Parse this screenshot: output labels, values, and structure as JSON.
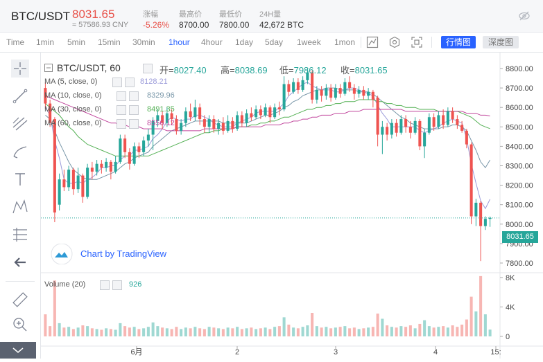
{
  "header": {
    "pair": "BTC/USDT",
    "price": "8031.65",
    "cny": "≈ 57586.93 CNY",
    "stats": [
      {
        "label": "涨幅",
        "value": "-5.26%",
        "color": "#e8524a"
      },
      {
        "label": "最高价",
        "value": "8700.00",
        "color": "#333333"
      },
      {
        "label": "最低价",
        "value": "7800.00",
        "color": "#333333"
      },
      {
        "label": "24H量",
        "value": "42,672 BTC",
        "color": "#333333"
      }
    ]
  },
  "toolbar": {
    "intervals": [
      "Time",
      "1min",
      "5min",
      "15min",
      "30min",
      "1hour",
      "4hour",
      "1day",
      "5day",
      "1week",
      "1mon"
    ],
    "active": "1hour",
    "view_kline": "行情图",
    "view_depth": "深度图"
  },
  "legend": {
    "title": "BTC/USDT, 60",
    "open_label": "开=",
    "open": "8027.40",
    "high_label": "高=",
    "high": "8038.69",
    "low_label": "低=",
    "low": "7986.12",
    "close_label": "收=",
    "close": "8031.65",
    "ma": [
      {
        "label": "MA (5, close, 0)",
        "value": "8128.21",
        "color": "#9a9ad9"
      },
      {
        "label": "MA (10, close, 0)",
        "value": "8329.96",
        "color": "#7896a8"
      },
      {
        "label": "MA (30, close, 0)",
        "value": "8491.35",
        "color": "#53b053"
      },
      {
        "label": "MA (60, close, 0)",
        "value": "8556.12",
        "color": "#c0449c"
      }
    ],
    "volume_label": "Volume (20)",
    "volume_value": "926",
    "tv_text": "Chart by TradingView"
  },
  "colors": {
    "up": "#26a69a",
    "down": "#ef5350",
    "up_vol": "#9fd8d2",
    "down_vol": "#f7b6b3"
  },
  "chart_data": {
    "type": "candlestick",
    "price_axis": [
      7800,
      7900,
      8000,
      8100,
      8200,
      8300,
      8400,
      8500,
      8600,
      8700,
      8800
    ],
    "volume_axis": [
      "0",
      "4K",
      "8K"
    ],
    "time_labels": [
      "6月",
      "2",
      "3",
      "4",
      "15:"
    ],
    "last_price": "8031.65",
    "candles": [
      {
        "o": 8700,
        "c": 8620,
        "h": 8730,
        "l": 8590
      },
      {
        "o": 8620,
        "c": 8520,
        "h": 8640,
        "l": 8500
      },
      {
        "o": 8540,
        "c": 8060,
        "h": 8550,
        "l": 8010
      },
      {
        "o": 8100,
        "c": 8230,
        "h": 8260,
        "l": 8070
      },
      {
        "o": 8230,
        "c": 8190,
        "h": 8280,
        "l": 8170
      },
      {
        "o": 8190,
        "c": 8280,
        "h": 8300,
        "l": 8170
      },
      {
        "o": 8280,
        "c": 8180,
        "h": 8290,
        "l": 8150
      },
      {
        "o": 8180,
        "c": 8250,
        "h": 8290,
        "l": 8160
      },
      {
        "o": 8250,
        "c": 8140,
        "h": 8260,
        "l": 8110
      },
      {
        "o": 8140,
        "c": 8290,
        "h": 8310,
        "l": 8130
      },
      {
        "o": 8290,
        "c": 8270,
        "h": 8320,
        "l": 8230
      },
      {
        "o": 8270,
        "c": 8310,
        "h": 8330,
        "l": 8250
      },
      {
        "o": 8310,
        "c": 8290,
        "h": 8330,
        "l": 8260
      },
      {
        "o": 8290,
        "c": 8320,
        "h": 8340,
        "l": 8270
      },
      {
        "o": 8320,
        "c": 8270,
        "h": 8330,
        "l": 8230
      },
      {
        "o": 8270,
        "c": 8320,
        "h": 8350,
        "l": 8260
      },
      {
        "o": 8320,
        "c": 8440,
        "h": 8460,
        "l": 8310
      },
      {
        "o": 8440,
        "c": 8370,
        "h": 8460,
        "l": 8340
      },
      {
        "o": 8370,
        "c": 8310,
        "h": 8390,
        "l": 8280
      },
      {
        "o": 8310,
        "c": 8400,
        "h": 8420,
        "l": 8300
      },
      {
        "o": 8400,
        "c": 8370,
        "h": 8420,
        "l": 8340
      },
      {
        "o": 8370,
        "c": 8430,
        "h": 8450,
        "l": 8350
      },
      {
        "o": 8430,
        "c": 8460,
        "h": 8490,
        "l": 8400
      },
      {
        "o": 8460,
        "c": 8530,
        "h": 8550,
        "l": 8380
      },
      {
        "o": 8530,
        "c": 8560,
        "h": 8590,
        "l": 8500
      },
      {
        "o": 8560,
        "c": 8520,
        "h": 8580,
        "l": 8490
      },
      {
        "o": 8520,
        "c": 8570,
        "h": 8600,
        "l": 8500
      },
      {
        "o": 8570,
        "c": 8540,
        "h": 8590,
        "l": 8510
      },
      {
        "o": 8540,
        "c": 8480,
        "h": 8560,
        "l": 8460
      },
      {
        "o": 8480,
        "c": 8520,
        "h": 8540,
        "l": 8460
      },
      {
        "o": 8520,
        "c": 8580,
        "h": 8600,
        "l": 8500
      },
      {
        "o": 8580,
        "c": 8550,
        "h": 8620,
        "l": 8530
      },
      {
        "o": 8550,
        "c": 8600,
        "h": 8640,
        "l": 8530
      },
      {
        "o": 8600,
        "c": 8540,
        "h": 8620,
        "l": 8510
      },
      {
        "o": 8540,
        "c": 8500,
        "h": 8560,
        "l": 8470
      },
      {
        "o": 8500,
        "c": 8540,
        "h": 8560,
        "l": 8470
      },
      {
        "o": 8540,
        "c": 8490,
        "h": 8560,
        "l": 8470
      },
      {
        "o": 8490,
        "c": 8520,
        "h": 8540,
        "l": 8460
      },
      {
        "o": 8520,
        "c": 8480,
        "h": 8550,
        "l": 8460
      },
      {
        "o": 8480,
        "c": 8530,
        "h": 8560,
        "l": 8470
      },
      {
        "o": 8530,
        "c": 8490,
        "h": 8550,
        "l": 8470
      },
      {
        "o": 8490,
        "c": 8560,
        "h": 8580,
        "l": 8480
      },
      {
        "o": 8560,
        "c": 8520,
        "h": 8580,
        "l": 8500
      },
      {
        "o": 8520,
        "c": 8570,
        "h": 8590,
        "l": 8500
      },
      {
        "o": 8570,
        "c": 8550,
        "h": 8600,
        "l": 8530
      },
      {
        "o": 8550,
        "c": 8590,
        "h": 8610,
        "l": 8540
      },
      {
        "o": 8590,
        "c": 8560,
        "h": 8610,
        "l": 8540
      },
      {
        "o": 8560,
        "c": 8600,
        "h": 8620,
        "l": 8550
      },
      {
        "o": 8600,
        "c": 8550,
        "h": 8610,
        "l": 8520
      },
      {
        "o": 8550,
        "c": 8600,
        "h": 8620,
        "l": 8540
      },
      {
        "o": 8600,
        "c": 8590,
        "h": 8630,
        "l": 8560
      },
      {
        "o": 8590,
        "c": 8720,
        "h": 8760,
        "l": 8580
      },
      {
        "o": 8720,
        "c": 8680,
        "h": 8740,
        "l": 8660
      },
      {
        "o": 8680,
        "c": 8730,
        "h": 8750,
        "l": 8670
      },
      {
        "o": 8730,
        "c": 8690,
        "h": 8750,
        "l": 8670
      },
      {
        "o": 8690,
        "c": 8740,
        "h": 8760,
        "l": 8680
      },
      {
        "o": 8740,
        "c": 8780,
        "h": 8800,
        "l": 8720
      },
      {
        "o": 8780,
        "c": 8640,
        "h": 8790,
        "l": 8620
      },
      {
        "o": 8640,
        "c": 8690,
        "h": 8710,
        "l": 8620
      },
      {
        "o": 8690,
        "c": 8660,
        "h": 8710,
        "l": 8630
      },
      {
        "o": 8660,
        "c": 8700,
        "h": 8720,
        "l": 8640
      },
      {
        "o": 8700,
        "c": 8650,
        "h": 8720,
        "l": 8630
      },
      {
        "o": 8650,
        "c": 8700,
        "h": 8720,
        "l": 8640
      },
      {
        "o": 8700,
        "c": 8670,
        "h": 8720,
        "l": 8650
      },
      {
        "o": 8670,
        "c": 8730,
        "h": 8750,
        "l": 8660
      },
      {
        "o": 8730,
        "c": 8700,
        "h": 8760,
        "l": 8680
      },
      {
        "o": 8700,
        "c": 8670,
        "h": 8720,
        "l": 8640
      },
      {
        "o": 8670,
        "c": 8690,
        "h": 8710,
        "l": 8650
      },
      {
        "o": 8690,
        "c": 8660,
        "h": 8710,
        "l": 8640
      },
      {
        "o": 8660,
        "c": 8680,
        "h": 8700,
        "l": 8640
      },
      {
        "o": 8680,
        "c": 8640,
        "h": 8690,
        "l": 8600
      },
      {
        "o": 8650,
        "c": 8460,
        "h": 8660,
        "l": 8400
      },
      {
        "o": 8460,
        "c": 8500,
        "h": 8530,
        "l": 8360
      },
      {
        "o": 8500,
        "c": 8460,
        "h": 8520,
        "l": 8430
      },
      {
        "o": 8460,
        "c": 8520,
        "h": 8540,
        "l": 8440
      },
      {
        "o": 8520,
        "c": 8470,
        "h": 8540,
        "l": 8450
      },
      {
        "o": 8470,
        "c": 8540,
        "h": 8560,
        "l": 8460
      },
      {
        "o": 8540,
        "c": 8500,
        "h": 8560,
        "l": 8470
      },
      {
        "o": 8500,
        "c": 8470,
        "h": 8530,
        "l": 8440
      },
      {
        "o": 8470,
        "c": 8530,
        "h": 8550,
        "l": 8460
      },
      {
        "o": 8530,
        "c": 8400,
        "h": 8540,
        "l": 8380
      },
      {
        "o": 8400,
        "c": 8470,
        "h": 8490,
        "l": 8340
      },
      {
        "o": 8470,
        "c": 8550,
        "h": 8570,
        "l": 8460
      },
      {
        "o": 8550,
        "c": 8500,
        "h": 8570,
        "l": 8480
      },
      {
        "o": 8500,
        "c": 8560,
        "h": 8580,
        "l": 8490
      },
      {
        "o": 8560,
        "c": 8510,
        "h": 8590,
        "l": 8490
      },
      {
        "o": 8510,
        "c": 8580,
        "h": 8600,
        "l": 8500
      },
      {
        "o": 8580,
        "c": 8540,
        "h": 8600,
        "l": 8520
      },
      {
        "o": 8540,
        "c": 8510,
        "h": 8560,
        "l": 8490
      },
      {
        "o": 8510,
        "c": 8480,
        "h": 8530,
        "l": 8470
      },
      {
        "o": 8480,
        "c": 8410,
        "h": 8490,
        "l": 8390
      },
      {
        "o": 8410,
        "c": 8040,
        "h": 8420,
        "l": 8000
      },
      {
        "o": 8040,
        "c": 8110,
        "h": 8130,
        "l": 7990
      },
      {
        "o": 8110,
        "c": 7990,
        "h": 8120,
        "l": 7810
      },
      {
        "o": 7990,
        "c": 8027,
        "h": 8040,
        "l": 7970
      },
      {
        "o": 8027,
        "c": 8032,
        "h": 8039,
        "l": 7986
      }
    ],
    "volumes": [
      3000,
      1400,
      7600,
      1800,
      1200,
      1300,
      1000,
      1200,
      1500,
      1400,
      1100,
      1000,
      900,
      1100,
      1000,
      900,
      1800,
      1400,
      1200,
      1300,
      1000,
      1100,
      1300,
      1900,
      1400,
      1200,
      1100,
      1000,
      1300,
      1000,
      1200,
      1100,
      1300,
      1100,
      1000,
      1300,
      1200,
      1100,
      1000,
      1200,
      1100,
      1300,
      1000,
      1100,
      1200,
      1000,
      1100,
      1200,
      1000,
      1300,
      1400,
      2600,
      1600,
      1200,
      1100,
      1300,
      1500,
      3200,
      1400,
      1200,
      1300,
      1100,
      1200,
      1300,
      1400,
      1100,
      1200,
      1000,
      1100,
      1200,
      1300,
      3100,
      2400,
      1500,
      1300,
      1200,
      1400,
      1300,
      1500,
      1100,
      1700,
      2200,
      1400,
      1200,
      1300,
      1400,
      1200,
      1500,
      1300,
      1600,
      2300,
      5400,
      3400,
      8200,
      3000,
      926
    ],
    "ma_series": {
      "ma5": {
        "color": "#9a9ad9",
        "values": [
          8600,
          8560,
          8430,
          8340,
          8230,
          8210,
          8210,
          8220,
          8210,
          8230,
          8240,
          8260,
          8290,
          8290,
          8300,
          8300,
          8330,
          8350,
          8350,
          8380,
          8380,
          8390,
          8400,
          8440,
          8460,
          8490,
          8530,
          8550,
          8540,
          8530,
          8540,
          8540,
          8560,
          8560,
          8550,
          8540,
          8520,
          8510,
          8500,
          8500,
          8500,
          8520,
          8530,
          8540,
          8550,
          8570,
          8580,
          8580,
          8580,
          8580,
          8600,
          8620,
          8660,
          8680,
          8700,
          8720,
          8730,
          8710,
          8700,
          8690,
          8690,
          8690,
          8680,
          8680,
          8690,
          8700,
          8700,
          8690,
          8680,
          8670,
          8660,
          8610,
          8570,
          8540,
          8500,
          8500,
          8500,
          8500,
          8500,
          8500,
          8480,
          8470,
          8480,
          8490,
          8500,
          8520,
          8530,
          8540,
          8530,
          8520,
          8440,
          8310,
          8210,
          8120,
          8080,
          8128
        ]
      },
      "ma10": {
        "color": "#7896a8",
        "values": [
          8560,
          8540,
          8480,
          8420,
          8370,
          8320,
          8280,
          8260,
          8240,
          8230,
          8230,
          8230,
          8240,
          8250,
          8260,
          8270,
          8290,
          8310,
          8320,
          8340,
          8350,
          8360,
          8370,
          8400,
          8420,
          8440,
          8460,
          8480,
          8490,
          8500,
          8510,
          8520,
          8530,
          8530,
          8530,
          8530,
          8530,
          8530,
          8520,
          8520,
          8520,
          8520,
          8520,
          8520,
          8530,
          8540,
          8550,
          8560,
          8560,
          8570,
          8580,
          8600,
          8610,
          8630,
          8640,
          8660,
          8670,
          8680,
          8690,
          8690,
          8700,
          8700,
          8700,
          8690,
          8690,
          8690,
          8690,
          8680,
          8680,
          8680,
          8670,
          8650,
          8630,
          8610,
          8590,
          8570,
          8550,
          8540,
          8520,
          8510,
          8500,
          8490,
          8490,
          8490,
          8490,
          8500,
          8500,
          8510,
          8510,
          8500,
          8480,
          8430,
          8380,
          8320,
          8290,
          8330
        ]
      },
      "ma30": {
        "color": "#53b053",
        "values": [
          8620,
          8600,
          8580,
          8560,
          8530,
          8500,
          8480,
          8450,
          8430,
          8410,
          8400,
          8390,
          8380,
          8370,
          8360,
          8350,
          8350,
          8350,
          8350,
          8350,
          8350,
          8350,
          8350,
          8360,
          8370,
          8380,
          8390,
          8400,
          8410,
          8420,
          8430,
          8440,
          8450,
          8460,
          8470,
          8470,
          8480,
          8480,
          8490,
          8490,
          8490,
          8500,
          8500,
          8500,
          8510,
          8510,
          8520,
          8520,
          8530,
          8530,
          8540,
          8550,
          8550,
          8560,
          8570,
          8580,
          8590,
          8590,
          8600,
          8600,
          8610,
          8610,
          8620,
          8620,
          8630,
          8630,
          8630,
          8640,
          8640,
          8640,
          8640,
          8630,
          8630,
          8620,
          8620,
          8610,
          8610,
          8600,
          8600,
          8600,
          8590,
          8590,
          8590,
          8590,
          8580,
          8580,
          8580,
          8580,
          8580,
          8570,
          8560,
          8550,
          8530,
          8510,
          8500,
          8491
        ]
      },
      "ma60": {
        "color": "#c0449c",
        "values": [
          8660,
          8650,
          8640,
          8630,
          8620,
          8610,
          8600,
          8590,
          8580,
          8570,
          8560,
          8550,
          8540,
          8530,
          8520,
          8520,
          8510,
          8510,
          8500,
          8500,
          8500,
          8490,
          8490,
          8490,
          8490,
          8490,
          8480,
          8480,
          8480,
          8480,
          8480,
          8480,
          8480,
          8480,
          8490,
          8490,
          8490,
          8490,
          8490,
          8490,
          8490,
          8500,
          8500,
          8500,
          8500,
          8500,
          8500,
          8510,
          8510,
          8510,
          8510,
          8520,
          8520,
          8530,
          8530,
          8540,
          8540,
          8550,
          8550,
          8560,
          8560,
          8560,
          8570,
          8570,
          8570,
          8580,
          8580,
          8580,
          8590,
          8590,
          8590,
          8590,
          8590,
          8590,
          8590,
          8590,
          8590,
          8580,
          8580,
          8580,
          8580,
          8580,
          8580,
          8580,
          8580,
          8580,
          8580,
          8580,
          8580,
          8580,
          8570,
          8570,
          8570,
          8560,
          8560,
          8556
        ]
      }
    }
  }
}
